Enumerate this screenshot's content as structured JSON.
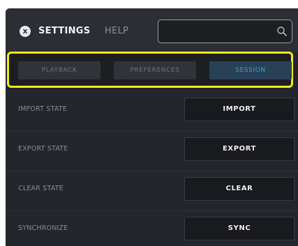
{
  "header": {
    "close_label": "x",
    "tabs": [
      {
        "label": "SETTINGS",
        "active": true
      },
      {
        "label": "HELP",
        "active": false
      }
    ],
    "search": {
      "value": "",
      "placeholder": ""
    }
  },
  "sub_tabs": [
    {
      "label": "PLAYBACK",
      "active": false
    },
    {
      "label": "PREFERENCES",
      "active": false
    },
    {
      "label": "SESSION",
      "active": true
    }
  ],
  "rows": [
    {
      "label": "IMPORT STATE",
      "button": "IMPORT"
    },
    {
      "label": "EXPORT STATE",
      "button": "EXPORT"
    },
    {
      "label": "CLEAR STATE",
      "button": "CLEAR"
    },
    {
      "label": "SYNCHRONIZE",
      "button": "SYNC"
    }
  ],
  "colors": {
    "panel_bg": "#23262c",
    "highlight_border": "#f2ea1d",
    "active_tab_text": "#38a0dc",
    "active_tab_bg": "#294157"
  }
}
